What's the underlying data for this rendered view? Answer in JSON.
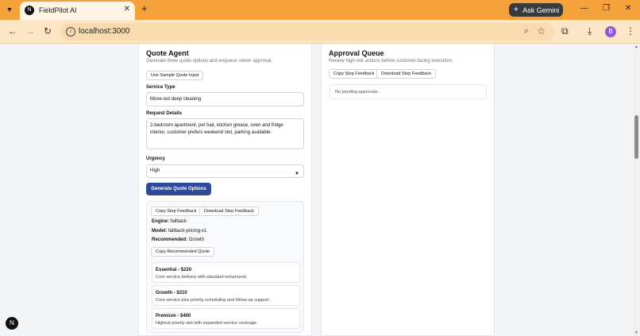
{
  "browser": {
    "tab_title": "FieldPilot AI",
    "new_tab": "+",
    "ask_gemini": "Ask Gemini",
    "url": "localhost:3000",
    "profile_initial": "B"
  },
  "quote_agent": {
    "title": "Quote Agent",
    "subtitle": "Generate three quote options and enqueue owner approval.",
    "sample_button": "Use Sample Quote Input",
    "service_type_label": "Service Type",
    "service_type_value": "Move-out deep cleaning",
    "request_details_label": "Request Details",
    "request_details_value": "2-bedroom apartment, pet hair, kitchen grease, oven and fridge interior, customer prefers weekend slot, parking available.",
    "urgency_label": "Urgency",
    "urgency_value": "High",
    "generate_button": "Generate Quote Options",
    "result": {
      "copy_feedback": "Copy Step Feedback",
      "download_feedback": "Download Step Feedback",
      "engine_label": "Engine:",
      "engine_value": "fallback",
      "model_label": "Model:",
      "model_value": "fallback-pricing-v1",
      "recommended_label": "Recommended:",
      "recommended_value": "Growth",
      "copy_recommended": "Copy Recommended Quote",
      "options": [
        {
          "title": "Essential - $220",
          "desc": "Core service delivery with standard turnaround."
        },
        {
          "title": "Growth - $310",
          "desc": "Core service plus priority scheduling and follow-up support."
        },
        {
          "title": "Premium - $400",
          "desc": "Highest priority slot with expanded service coverage."
        }
      ]
    }
  },
  "approval_queue": {
    "title": "Approval Queue",
    "subtitle": "Review high-risk actions before customer-facing execution.",
    "copy_feedback": "Copy Step Feedback",
    "download_feedback": "Download Step Feedback",
    "empty_text": "No pending approvals."
  },
  "icons": {
    "tab_menu": "chevron-down-icon",
    "favicon": "nextjs-icon",
    "back": "back-arrow-icon",
    "forward": "forward-arrow-icon",
    "reload": "reload-icon",
    "site_info": "site-info-icon",
    "zoom": "zoom-icon",
    "bookmark": "star-icon",
    "extensions": "puzzle-icon",
    "download": "download-icon",
    "menu": "kebab-menu-icon"
  },
  "colors": {
    "tabbar": "#f6a23c",
    "toolbar": "#fde6c6",
    "primary_button": "#2f4a9a",
    "profile": "#8e5bd6"
  }
}
